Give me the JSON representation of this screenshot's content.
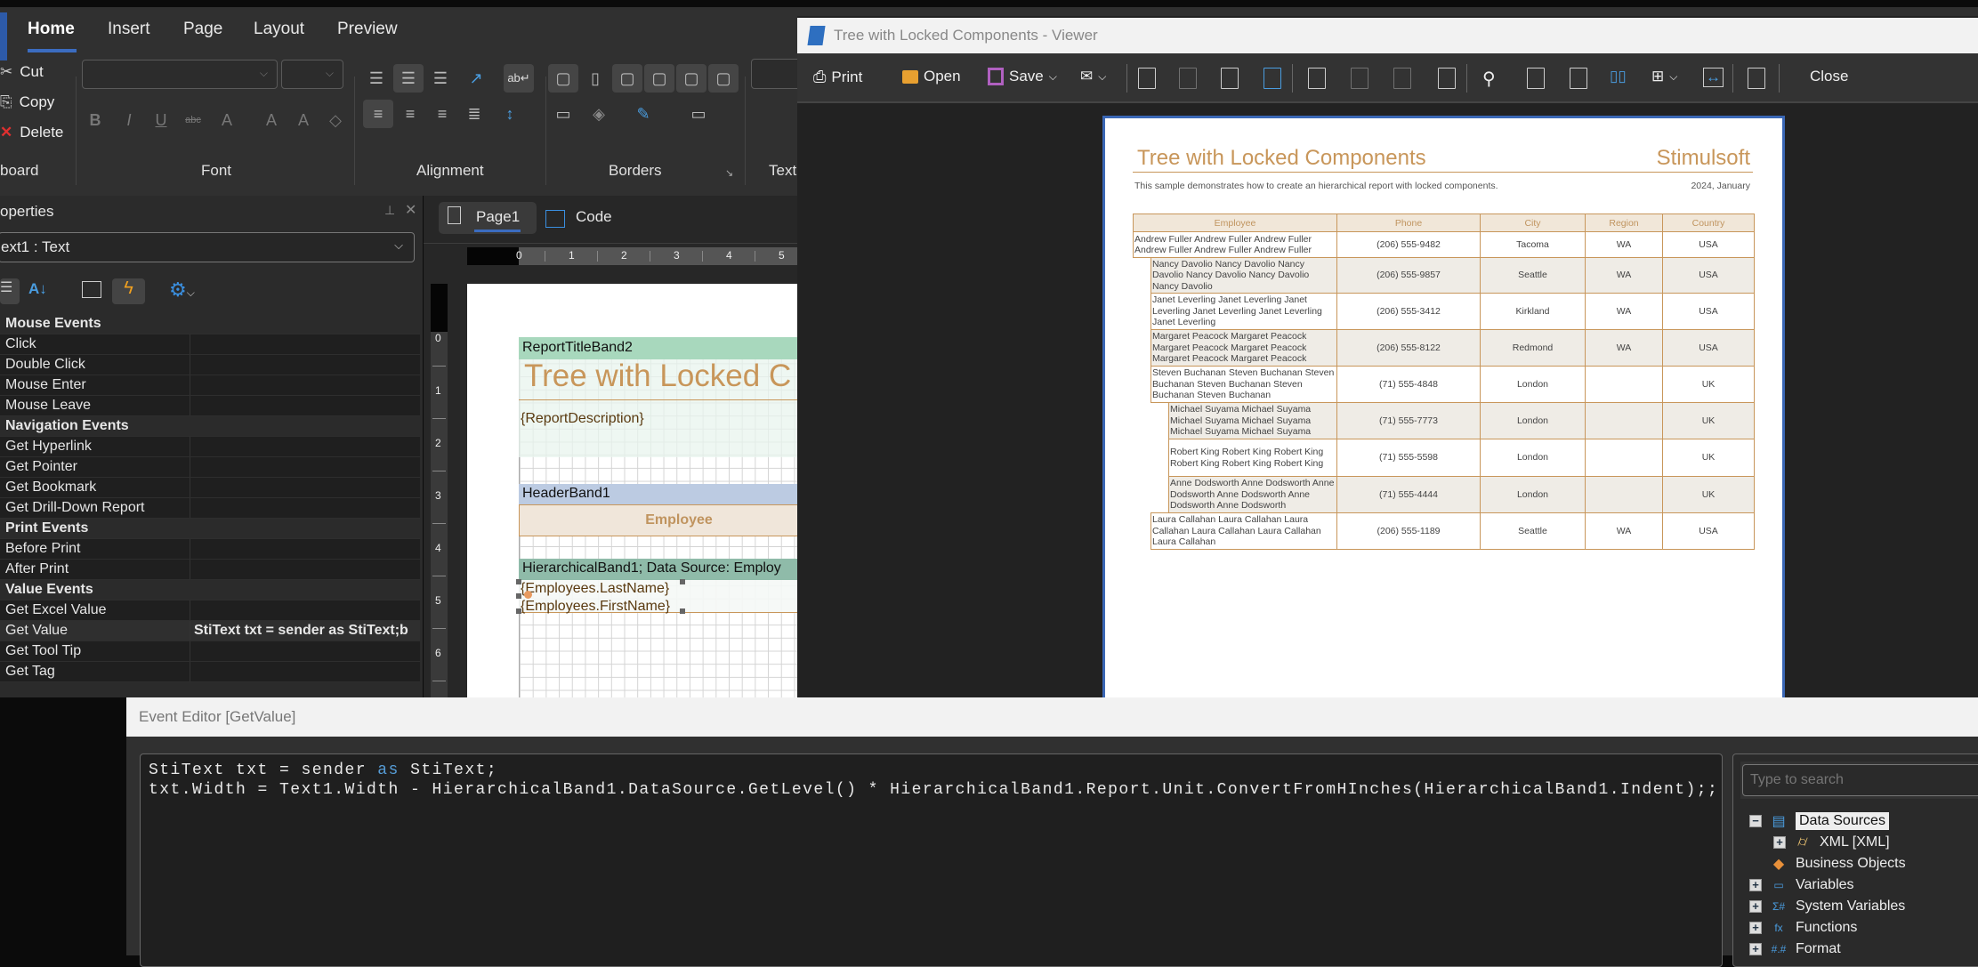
{
  "ribbon": {
    "tabs": [
      "Home",
      "Insert",
      "Page",
      "Layout",
      "Preview"
    ],
    "active_tab": "Home",
    "clipboard": {
      "cut": "Cut",
      "copy": "Copy",
      "delete": "Delete"
    },
    "groups": {
      "clipboard": "board",
      "font": "Font",
      "alignment": "Alignment",
      "borders": "Borders",
      "text": "Text"
    },
    "font_buttons": [
      "B",
      "I",
      "U",
      "abc",
      "A",
      "A",
      "A"
    ]
  },
  "properties": {
    "title": "operties",
    "selected_component": "ext1 : Text",
    "groups": [
      {
        "title": "Mouse  Events",
        "items": [
          {
            "name": "Click",
            "value": ""
          },
          {
            "name": "Double Click",
            "value": ""
          },
          {
            "name": "Mouse Enter",
            "value": ""
          },
          {
            "name": "Mouse Leave",
            "value": ""
          }
        ]
      },
      {
        "title": "Navigation  Events",
        "items": [
          {
            "name": "Get Hyperlink",
            "value": ""
          },
          {
            "name": "Get Pointer",
            "value": ""
          },
          {
            "name": "Get Bookmark",
            "value": ""
          },
          {
            "name": "Get Drill-Down Report",
            "value": ""
          }
        ]
      },
      {
        "title": "Print  Events",
        "items": [
          {
            "name": "Before Print",
            "value": ""
          },
          {
            "name": "After Print",
            "value": ""
          }
        ]
      },
      {
        "title": "Value  Events",
        "items": [
          {
            "name": "Get Excel Value",
            "value": ""
          },
          {
            "name": "Get Value",
            "value": "StiText txt = sender as StiText;b",
            "selected": true
          },
          {
            "name": "Get Tool Tip",
            "value": ""
          },
          {
            "name": "Get Tag",
            "value": ""
          }
        ]
      }
    ]
  },
  "designer": {
    "tabs": {
      "page": "Page1",
      "code": "Code"
    },
    "ruler_h": [
      "0",
      "1",
      "2",
      "3",
      "4",
      "5"
    ],
    "ruler_v": [
      "0",
      "1",
      "2",
      "3",
      "4",
      "5",
      "6"
    ],
    "bands": {
      "title_band": "ReportTitleBand2",
      "title_text": "Tree with Locked C",
      "description": "{ReportDescription}",
      "header_band": "HeaderBand1",
      "header_cell": "Employee",
      "hier_band": "HierarchicalBand1; Data Source: Employ",
      "last_name": "{Employees.LastName}",
      "first_name": "{Employees.FirstName}"
    }
  },
  "viewer": {
    "window_title": "Tree with Locked Components - Viewer",
    "toolbar": {
      "print": "Print",
      "open": "Open",
      "save": "Save",
      "close": "Close"
    },
    "report": {
      "title": "Tree with Locked Components",
      "brand": "Stimulsoft",
      "description": "This sample demonstrates how to create an hierarchical report with locked components.",
      "date": "2024, January",
      "columns": [
        "Employee",
        "Phone",
        "City",
        "Region",
        "Country"
      ],
      "rows": [
        {
          "employee": "Andrew Fuller Andrew Fuller Andrew Fuller Andrew Fuller Andrew Fuller Andrew Fuller",
          "phone": "(206) 555-9482",
          "city": "Tacoma",
          "region": "WA",
          "country": "USA",
          "level": 0
        },
        {
          "employee": "Nancy Davolio Nancy Davolio Nancy Davolio Nancy Davolio Nancy Davolio Nancy Davolio",
          "phone": "(206) 555-9857",
          "city": "Seattle",
          "region": "WA",
          "country": "USA",
          "level": 1
        },
        {
          "employee": "Janet Leverling Janet Leverling Janet Leverling Janet Leverling Janet Leverling Janet Leverling",
          "phone": "(206) 555-3412",
          "city": "Kirkland",
          "region": "WA",
          "country": "USA",
          "level": 1
        },
        {
          "employee": "Margaret Peacock Margaret Peacock Margaret Peacock Margaret Peacock Margaret Peacock Margaret Peacock",
          "phone": "(206) 555-8122",
          "city": "Redmond",
          "region": "WA",
          "country": "USA",
          "level": 1
        },
        {
          "employee": "Steven Buchanan Steven Buchanan Steven Buchanan Steven Buchanan Steven Buchanan Steven Buchanan",
          "phone": "(71) 555-4848",
          "city": "London",
          "region": "",
          "country": "UK",
          "level": 1
        },
        {
          "employee": "Michael Suyama Michael Suyama Michael Suyama Michael Suyama Michael Suyama Michael Suyama",
          "phone": "(71) 555-7773",
          "city": "London",
          "region": "",
          "country": "UK",
          "level": 2
        },
        {
          "employee": "Robert King Robert King Robert King Robert King Robert King Robert King",
          "phone": "(71) 555-5598",
          "city": "London",
          "region": "",
          "country": "UK",
          "level": 2
        },
        {
          "employee": "Anne Dodsworth Anne Dodsworth Anne Dodsworth Anne Dodsworth Anne Dodsworth Anne Dodsworth",
          "phone": "(71) 555-4444",
          "city": "London",
          "region": "",
          "country": "UK",
          "level": 2
        },
        {
          "employee": "Laura Callahan Laura Callahan Laura Callahan Laura Callahan Laura Callahan Laura Callahan",
          "phone": "(206) 555-1189",
          "city": "Seattle",
          "region": "WA",
          "country": "USA",
          "level": 1
        }
      ]
    }
  },
  "event_editor": {
    "title": "Event Editor [GetValue]",
    "code_line1_a": "StiText txt = sender ",
    "code_line1_kw": "as",
    "code_line1_b": " StiText;",
    "code_line2": "txt.Width = Text1.Width - HierarchicalBand1.DataSource.GetLevel() * HierarchicalBand1.Report.Unit.ConvertFromHInches(HierarchicalBand1.Indent);;",
    "search_placeholder": "Type to search",
    "tree": [
      "Data Sources",
      "XML [XML]",
      "Business Objects",
      "Variables",
      "System Variables",
      "Functions",
      "Format"
    ]
  },
  "colors": {
    "accent": "#3b6cc0",
    "report_gold": "#c8965a",
    "keyword": "#569cd6"
  }
}
